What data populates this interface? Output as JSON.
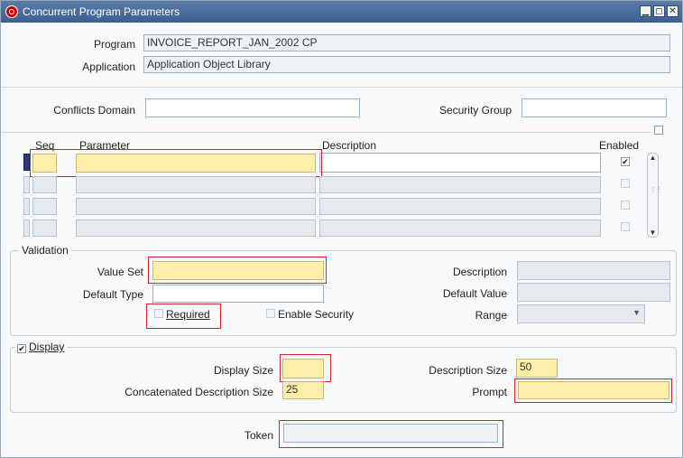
{
  "window": {
    "title": "Concurrent Program Parameters",
    "controls": [
      "▁",
      "◻",
      "✕"
    ]
  },
  "header": {
    "program_label": "Program",
    "program_value": "INVOICE_REPORT_JAN_2002 CP",
    "application_label": "Application",
    "application_value": "Application Object Library",
    "conflicts_label": "Conflicts Domain",
    "conflicts_value": "",
    "security_group_label": "Security Group",
    "security_group_value": ""
  },
  "grid": {
    "headers": {
      "seq": "Seq",
      "parameter": "Parameter",
      "description": "Description",
      "enabled": "Enabled"
    },
    "rows": [
      {
        "seq": "",
        "parameter": "",
        "description": "",
        "enabled": "✔"
      },
      {
        "seq": "",
        "parameter": "",
        "description": "",
        "enabled": ""
      },
      {
        "seq": "",
        "parameter": "",
        "description": "",
        "enabled": ""
      },
      {
        "seq": "",
        "parameter": "",
        "description": "",
        "enabled": ""
      }
    ],
    "scroll_up": "▲",
    "scroll_down": "▼",
    "scroll_grip": "⋮⋮"
  },
  "validation": {
    "legend": "Validation",
    "value_set_label": "Value Set",
    "value_set_value": "",
    "default_type_label": "Default Type",
    "default_type_value": "",
    "required_label": "Required",
    "enable_security_label": "Enable Security",
    "description_label": "Description",
    "description_value": "",
    "default_value_label": "Default Value",
    "default_value_value": "",
    "range_label": "Range",
    "range_value": "",
    "range_arrow": "▼"
  },
  "display": {
    "legend": "Display",
    "checked_mark": "✔",
    "display_size_label": "Display Size",
    "display_size_value": "",
    "concat_label": "Concatenated Description Size",
    "concat_value": "25",
    "desc_size_label": "Description Size",
    "desc_size_value": "50",
    "prompt_label": "Prompt",
    "prompt_value": ""
  },
  "token": {
    "label": "Token",
    "value": ""
  },
  "colors": {
    "titlebar": "#3d5f8f",
    "required_field": "#fdeeaa",
    "highlight": "#d9232e",
    "current_record": "#2d3a7a"
  }
}
